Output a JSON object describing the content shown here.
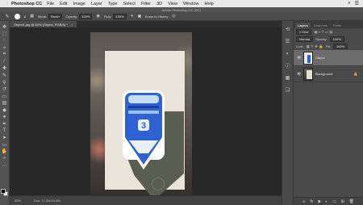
{
  "menubar": {
    "app_name": "Photoshop CC",
    "items": [
      "File",
      "Edit",
      "Image",
      "Layer",
      "Type",
      "Select",
      "Filter",
      "3D",
      "View",
      "Window",
      "Help"
    ]
  },
  "titlebar": {
    "title": "Adobe Photoshop CC 2017"
  },
  "options": {
    "brush_size": "8",
    "mode_label": "Mode:",
    "mode_value": "Brush",
    "opacity_label": "Opacity:",
    "opacity_value": "100%",
    "flow_label": "Flow:",
    "flow_value": "100%",
    "erase_history_label": "Erase to History"
  },
  "document": {
    "tab_title": "Object1.jpg @ 60% (Object, RGB/8) *",
    "close": "×"
  },
  "status": {
    "zoom": "60%",
    "doc_info": "Doc: 17.2M/19.0M"
  },
  "layers_panel": {
    "tabs": [
      "Layers",
      "Channels",
      "Paths"
    ],
    "blend_mode": "Normal",
    "opacity_label": "Opacity:",
    "opacity_value": "100%",
    "lock_label": "Lock:",
    "fill_label": "Fill:",
    "fill_value": "100%",
    "layers": [
      {
        "name": "Object",
        "selected": true
      },
      {
        "name": "Background",
        "selected": false
      }
    ]
  },
  "sticker": {
    "number": "3"
  },
  "colors": {
    "accent": "#2f61d0",
    "panel": "#4a4a4a",
    "canvas_bg": "#282828"
  }
}
